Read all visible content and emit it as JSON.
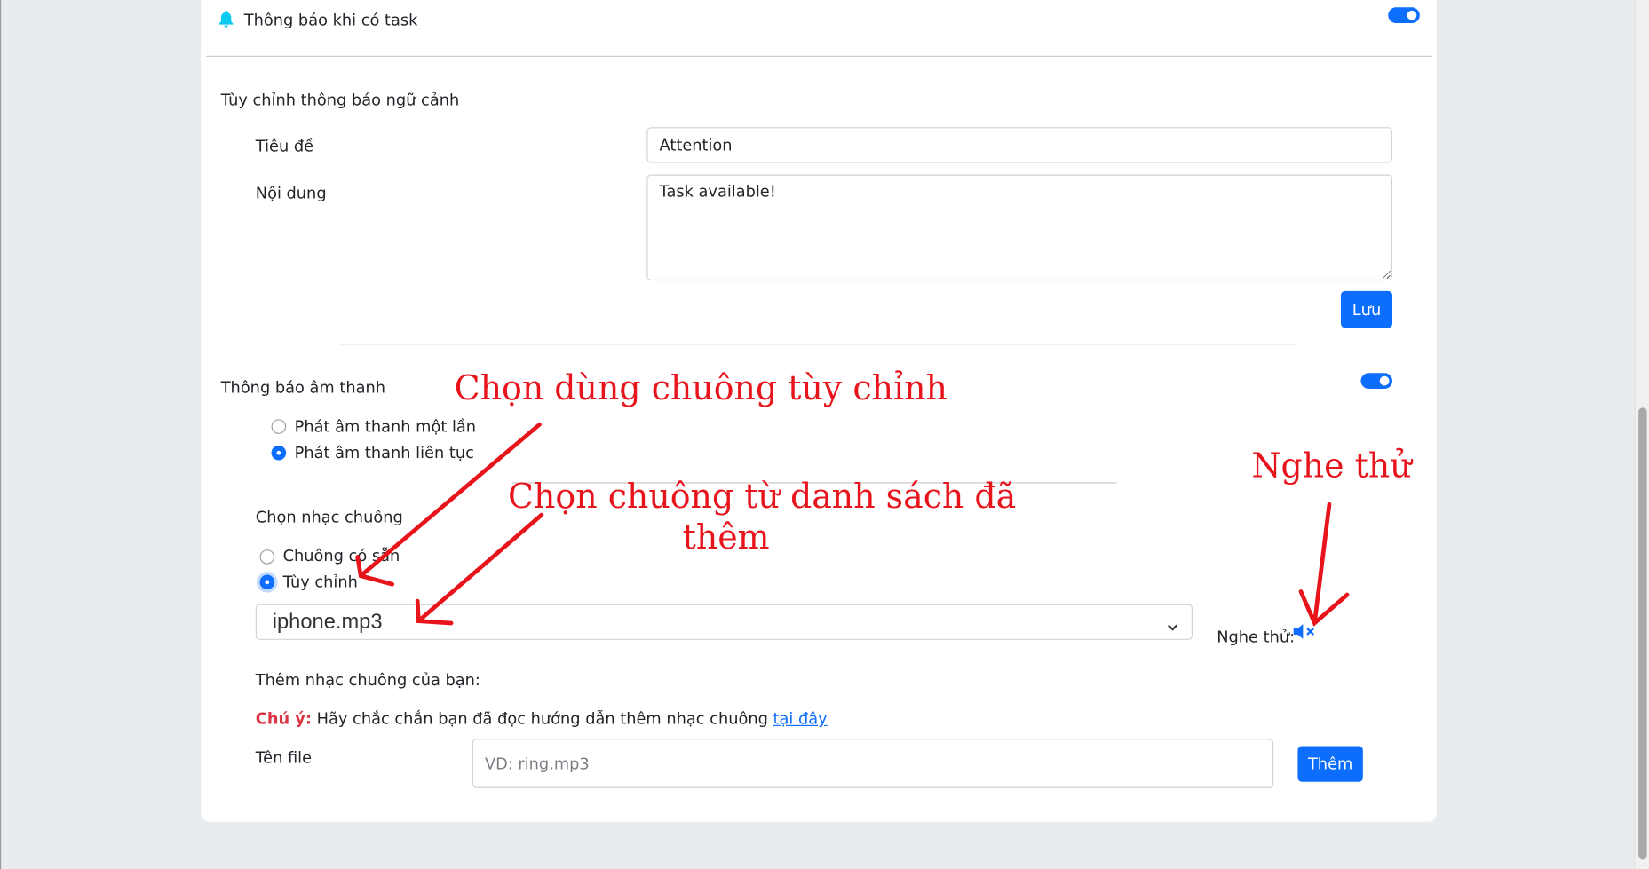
{
  "notify_task": {
    "label": "Thông báo khi có task",
    "toggle_on": true
  },
  "context": {
    "section_title": "Tùy chỉnh thông báo ngữ cảnh",
    "title_label": "Tiêu đề",
    "title_value": "Attention",
    "content_label": "Nội dung",
    "content_value": "Task available!",
    "save_label": "Lưu"
  },
  "sound": {
    "section_title": "Thông báo âm thanh",
    "toggle_on": true,
    "play_once": "Phát âm thanh một lần",
    "play_loop": "Phát âm thanh liên tục",
    "ringtone_title": "Chọn nhạc chuông",
    "builtin": "Chuông có sẵn",
    "custom": "Tùy chỉnh",
    "selected_file": "iphone.mp3",
    "preview_label": "Nghe thử:"
  },
  "add_ringtone": {
    "title": "Thêm nhạc chuông của bạn:",
    "note_prefix": "Chú ý:",
    "note_text": " Hãy chắc chắn bạn đã đọc hướng dẫn thêm nhạc chuông ",
    "note_link": "tại đây",
    "file_label": "Tên file",
    "file_placeholder": "VD: ring.mp3",
    "add_button": "Thêm"
  },
  "annotations": {
    "a1": "Chọn dùng chuông tùy chỉnh",
    "a2_line1": "Chọn chuông từ danh sách đã",
    "a2_line2": "thêm",
    "a3": "Nghe thử"
  },
  "colors": {
    "accent": "#0d6efd",
    "annotation": "#e8141c",
    "warning": "#dc3545"
  }
}
